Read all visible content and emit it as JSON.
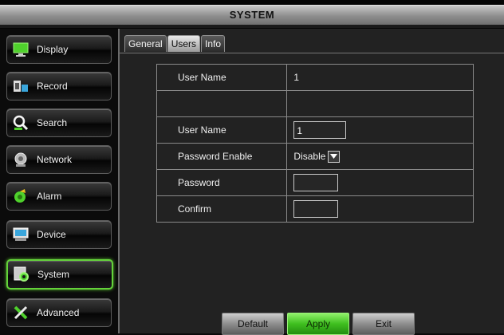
{
  "window": {
    "title": "SYSTEM"
  },
  "sidebar": {
    "items": [
      {
        "label": "Display",
        "icon": "monitor-icon"
      },
      {
        "label": "Record",
        "icon": "record-icon"
      },
      {
        "label": "Search",
        "icon": "search-icon"
      },
      {
        "label": "Network",
        "icon": "network-icon"
      },
      {
        "label": "Alarm",
        "icon": "alarm-icon"
      },
      {
        "label": "Device",
        "icon": "device-icon"
      },
      {
        "label": "System",
        "icon": "system-gear-icon",
        "active": true
      },
      {
        "label": "Advanced",
        "icon": "tools-icon"
      }
    ]
  },
  "tabs": [
    {
      "label": "General"
    },
    {
      "label": "Users",
      "active": true
    },
    {
      "label": "Info"
    }
  ],
  "users_form": {
    "header_row": {
      "label": "User Name",
      "value": "1"
    },
    "user_name": {
      "label": "User Name",
      "value": "1"
    },
    "password_enable": {
      "label": "Password Enable",
      "value": "Disable"
    },
    "password": {
      "label": "Password",
      "value": ""
    },
    "confirm": {
      "label": "Confirm",
      "value": ""
    }
  },
  "buttons": {
    "default_label": "Default",
    "apply_label": "Apply",
    "exit_label": "Exit"
  },
  "colors": {
    "accent_green": "#5ac02f",
    "panel_background": "#222222",
    "title_bar": "#9a9a9a"
  }
}
